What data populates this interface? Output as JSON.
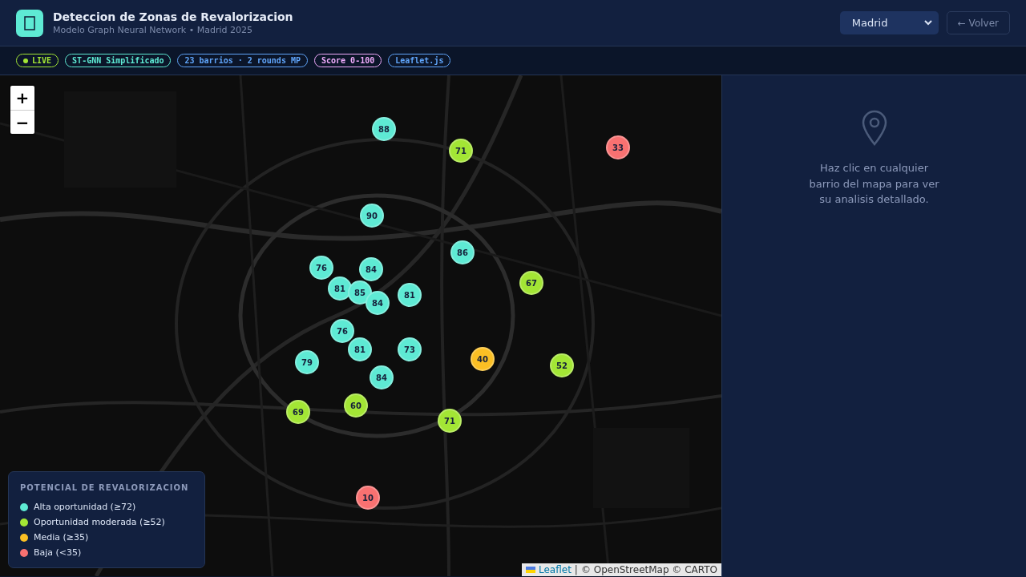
{
  "header": {
    "title": "Deteccion de Zonas de Revalorizacion",
    "subtitle": "Modelo Graph Neural Network • Madrid 2025",
    "city_select": {
      "value": "Madrid"
    },
    "back_button": "← Volver"
  },
  "badges": [
    {
      "label": "LIVE",
      "kind": "live",
      "color": "#a3e635"
    },
    {
      "label": "ST-GNN Simplificado",
      "kind": "plain",
      "color": "#5eead4"
    },
    {
      "label": "23 barrios · 2 rounds MP",
      "kind": "plain",
      "color": "#60a5fa"
    },
    {
      "label": "Score 0-100",
      "kind": "plain",
      "color": "#f0abfc"
    },
    {
      "label": "Leaflet.js",
      "kind": "plain",
      "color": "#60a5fa"
    }
  ],
  "map": {
    "zoom_in": "+",
    "zoom_out": "−",
    "markers": [
      {
        "score": "88",
        "color": "#5eead4"
      },
      {
        "score": "71",
        "color": "#a3e635"
      },
      {
        "score": "33",
        "color": "#f87171"
      },
      {
        "score": "90",
        "color": "#5eead4"
      },
      {
        "score": "86",
        "color": "#5eead4"
      },
      {
        "score": "76",
        "color": "#5eead4"
      },
      {
        "score": "84",
        "color": "#5eead4"
      },
      {
        "score": "67",
        "color": "#a3e635"
      },
      {
        "score": "81",
        "color": "#5eead4"
      },
      {
        "score": "85",
        "color": "#5eead4"
      },
      {
        "score": "84",
        "color": "#5eead4"
      },
      {
        "score": "81",
        "color": "#5eead4"
      },
      {
        "score": "76",
        "color": "#5eead4"
      },
      {
        "score": "81",
        "color": "#5eead4"
      },
      {
        "score": "73",
        "color": "#5eead4"
      },
      {
        "score": "79",
        "color": "#5eead4"
      },
      {
        "score": "40",
        "color": "#fbbf24"
      },
      {
        "score": "52",
        "color": "#a3e635"
      },
      {
        "score": "84",
        "color": "#5eead4"
      },
      {
        "score": "69",
        "color": "#a3e635"
      },
      {
        "score": "60",
        "color": "#a3e635"
      },
      {
        "score": "71",
        "color": "#a3e635"
      },
      {
        "score": "10",
        "color": "#f87171"
      }
    ],
    "legend": {
      "title": "POTENCIAL DE REVALORIZACION",
      "items": [
        {
          "label": "Alta oportunidad (≥72)",
          "color": "#5eead4"
        },
        {
          "label": "Oportunidad moderada (≥52)",
          "color": "#a3e635"
        },
        {
          "label": "Media (≥35)",
          "color": "#fbbf24"
        },
        {
          "label": "Baja (<35)",
          "color": "#f87171"
        }
      ]
    },
    "attribution": {
      "link": "Leaflet",
      "separator": "|",
      "text": "© OpenStreetMap © CARTO"
    }
  },
  "detail_panel": {
    "message": "Haz clic en cualquier barrio del mapa para ver su analisis detallado."
  }
}
